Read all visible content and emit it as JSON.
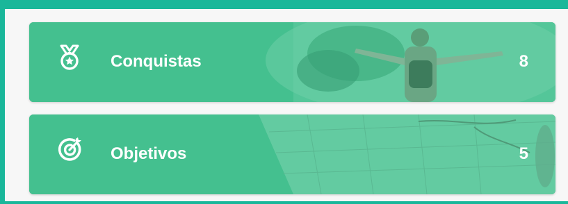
{
  "colors": {
    "frame_accent": "#19b79a",
    "card_green": "#44c08f",
    "text": "#ffffff"
  },
  "cards": [
    {
      "label": "Conquistas",
      "count": "8",
      "icon": "medal-icon"
    },
    {
      "label": "Objetivos",
      "count": "5",
      "icon": "target-icon"
    }
  ]
}
